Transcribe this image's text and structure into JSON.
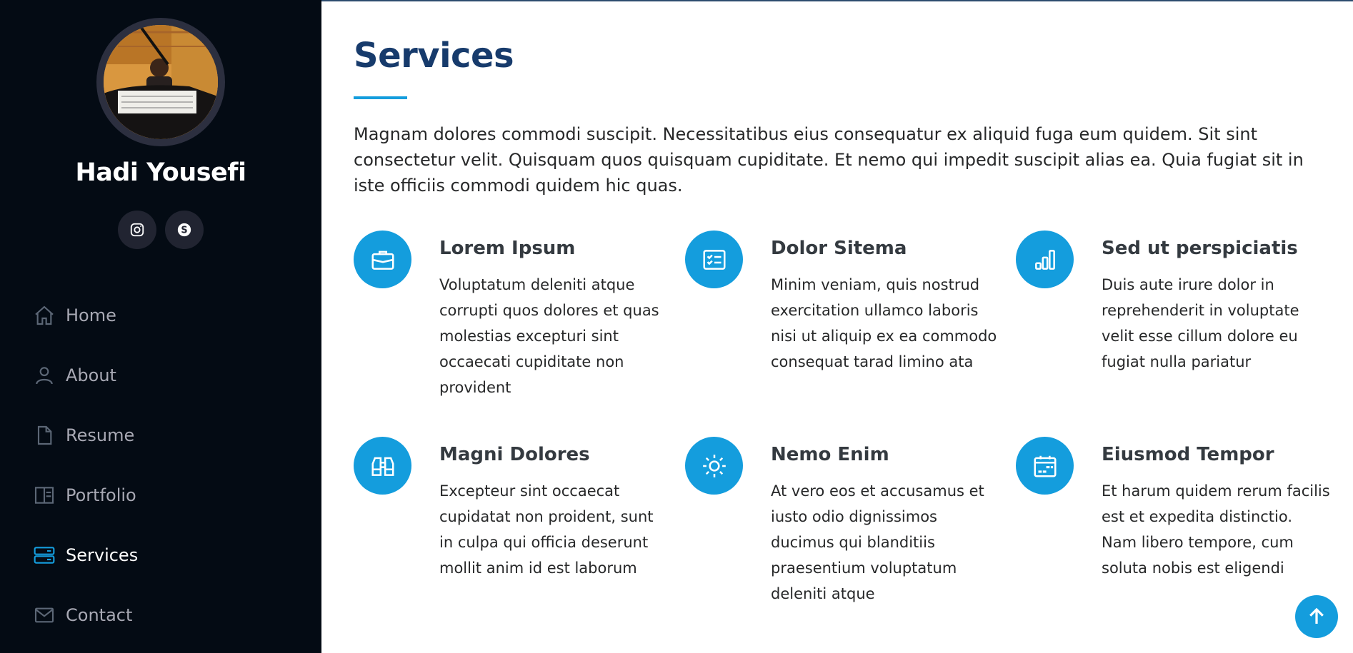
{
  "profile": {
    "name": "Hadi Yousefi",
    "socials": [
      {
        "icon": "instagram-icon"
      },
      {
        "icon": "skype-icon"
      }
    ]
  },
  "nav": {
    "items": [
      {
        "label": "Home",
        "icon": "home-icon"
      },
      {
        "label": "About",
        "icon": "person-icon"
      },
      {
        "label": "Resume",
        "icon": "file-icon"
      },
      {
        "label": "Portfolio",
        "icon": "layout-icon"
      },
      {
        "label": "Services",
        "icon": "server-icon",
        "active": true
      },
      {
        "label": "Contact",
        "icon": "envelope-icon"
      }
    ]
  },
  "services": {
    "title": "Services",
    "intro": "Magnam dolores commodi suscipit. Necessitatibus eius consequatur ex aliquid fuga eum quidem. Sit sint consectetur velit. Quisquam quos quisquam cupiditate. Et nemo qui impedit suscipit alias ea. Quia fugiat sit in iste officiis commodi quidem hic quas.",
    "items": [
      {
        "title": "Lorem Ipsum",
        "desc": "Voluptatum deleniti atque corrupti quos dolores et quas molestias excepturi sint occaecati cupiditate non provident",
        "icon": "briefcase-icon"
      },
      {
        "title": "Dolor Sitema",
        "desc": "Minim veniam, quis nostrud exercitation ullamco laboris nisi ut aliquip ex ea commodo consequat tarad limino ata",
        "icon": "card-checklist-icon"
      },
      {
        "title": "Sed ut perspiciatis",
        "desc": "Duis aute irure dolor in reprehenderit in voluptate velit esse cillum dolore eu fugiat nulla pariatur",
        "icon": "bar-chart-icon"
      },
      {
        "title": "Magni Dolores",
        "desc": "Excepteur sint occaecat cupidatat non proident, sunt in culpa qui officia deserunt mollit anim id est laborum",
        "icon": "binoculars-icon"
      },
      {
        "title": "Nemo Enim",
        "desc": "At vero eos et accusamus et iusto odio dignissimos ducimus qui blanditiis praesentium voluptatum deleniti atque",
        "icon": "brightness-icon"
      },
      {
        "title": "Eiusmod Tempor",
        "desc": "Et harum quidem rerum facilis est et expedita distinctio. Nam libero tempore, cum soluta nobis est eligendi",
        "icon": "calendar-icon"
      }
    ]
  },
  "colors": {
    "accent": "#149ddd",
    "sidebar_bg": "#040b14",
    "heading": "#173b6c"
  }
}
